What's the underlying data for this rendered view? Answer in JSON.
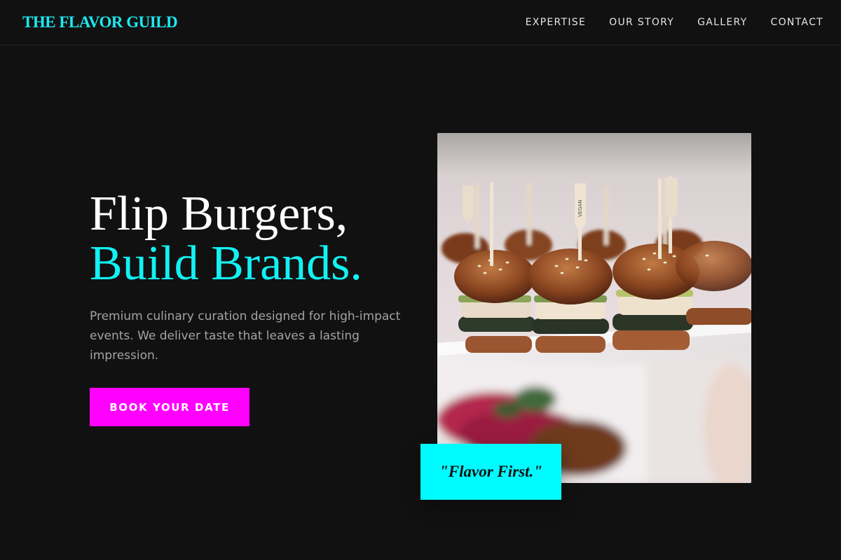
{
  "brand": {
    "name": "THE FLAVOR GUILD"
  },
  "nav": {
    "items": [
      {
        "label": "EXPERTISE"
      },
      {
        "label": "OUR STORY"
      },
      {
        "label": "GALLERY"
      },
      {
        "label": "CONTACT"
      }
    ]
  },
  "hero": {
    "title_line1": "Flip Burgers,",
    "title_line2": "Build Brands.",
    "description": "Premium culinary curation designed for high-impact events. We deliver taste that leaves a lasting impression.",
    "cta_label": "BOOK YOUR DATE",
    "quote": "\"Flavor First.\"",
    "image_label": "VEGAN"
  },
  "colors": {
    "background": "#111111",
    "accent_cyan": "#12f1f4",
    "accent_magenta": "#ff00ff",
    "body_text": "#a3a3a3"
  }
}
